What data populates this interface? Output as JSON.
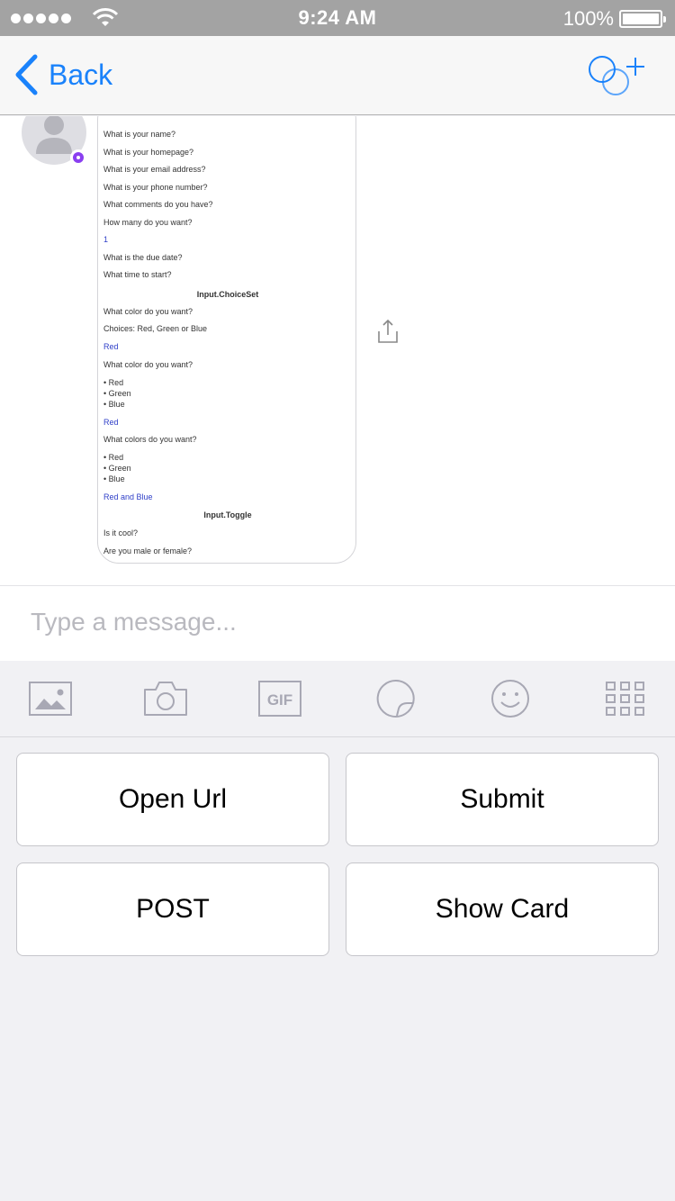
{
  "status_bar": {
    "time": "9:24 AM",
    "battery_percent": "100%",
    "signal_bars": 5
  },
  "nav": {
    "back_label": "Back",
    "back_icon": "chevron-left-icon",
    "right_icon": "add-participant-icon",
    "accent_color": "#1a82fb"
  },
  "card": {
    "lines": [
      "What is your name?",
      "What is your homepage?",
      "What is your email address?",
      "What is your phone number?",
      "What comments do you have?",
      "How many do you want?",
      "1",
      "What is the due date?",
      "What time to start?",
      "Input.ChoiceSet",
      "What color do you want?",
      "Choices: Red, Green or Blue",
      "Red",
      "What color do you want?",
      "• Red",
      "• Green",
      "• Blue",
      "Red",
      "What colors do you want?",
      "• Red",
      "• Green",
      "• Blue",
      "Red and Blue",
      "Input.Toggle",
      "Is it cool?",
      "Are you male or female?"
    ]
  },
  "composer": {
    "placeholder": "Type a message..."
  },
  "toolbar": {
    "icons": [
      "photo-icon",
      "camera-icon",
      "gif-icon",
      "sticker-icon",
      "emoji-icon",
      "apps-grid-icon"
    ],
    "gif_label": "GIF"
  },
  "actions": {
    "open_url": "Open Url",
    "submit": "Submit",
    "post": "POST",
    "show_card": "Show Card"
  }
}
